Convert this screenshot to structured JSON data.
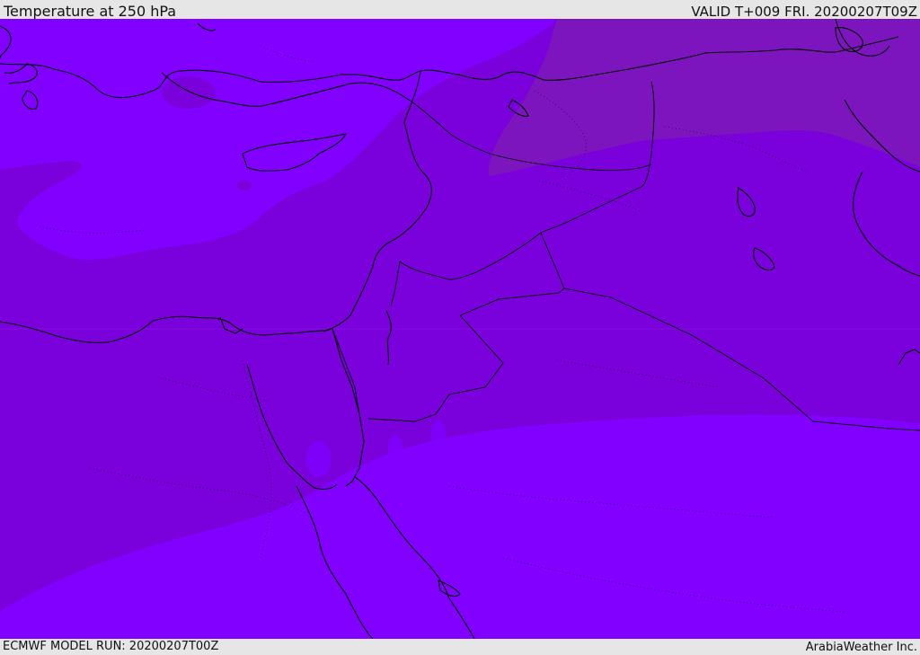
{
  "header": {
    "title": "Temperature at 250 hPa",
    "valid": "VALID T+009 FRI. 20200207T09Z"
  },
  "footer": {
    "model_run": "ECMWF MODEL RUN: 20200207T00Z",
    "credit": "ArabiaWeather Inc."
  },
  "map": {
    "field": "temperature",
    "level": "250 hPa",
    "colors": {
      "band_warm": "#7a00dc",
      "band_mid": "#8100ff",
      "band_cold": "#7d15be",
      "coastline": "#000000"
    }
  }
}
